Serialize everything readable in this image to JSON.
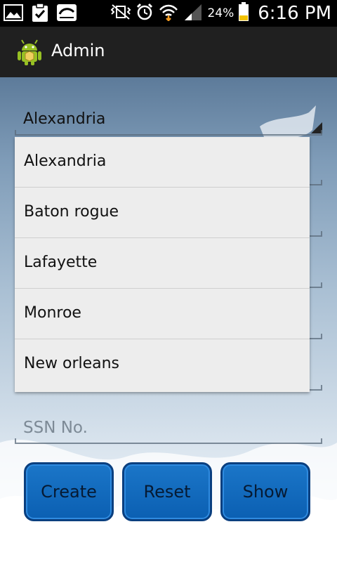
{
  "status_bar": {
    "battery_percent": "24%",
    "time": "6:16 PM",
    "icons": [
      "gallery-icon",
      "clipboard-check-icon",
      "voicemail-icon",
      "vibrate-mute-icon",
      "alarm-icon",
      "wifi-icon",
      "signal-icon",
      "battery-icon"
    ]
  },
  "action_bar": {
    "title": "Admin",
    "icon": "android-robot-icon"
  },
  "form": {
    "city_spinner": {
      "selected": "Alexandria"
    },
    "ssn_field": {
      "placeholder": "SSN No."
    }
  },
  "dropdown": {
    "options": [
      "Alexandria",
      "Baton rogue",
      "Lafayette",
      "Monroe",
      "New orleans"
    ]
  },
  "buttons": {
    "create": "Create",
    "reset": "Reset",
    "show": "Show"
  },
  "colors": {
    "button_blue": "#0b6bc0",
    "action_bar": "#202020",
    "dropdown_bg": "#ededed"
  }
}
